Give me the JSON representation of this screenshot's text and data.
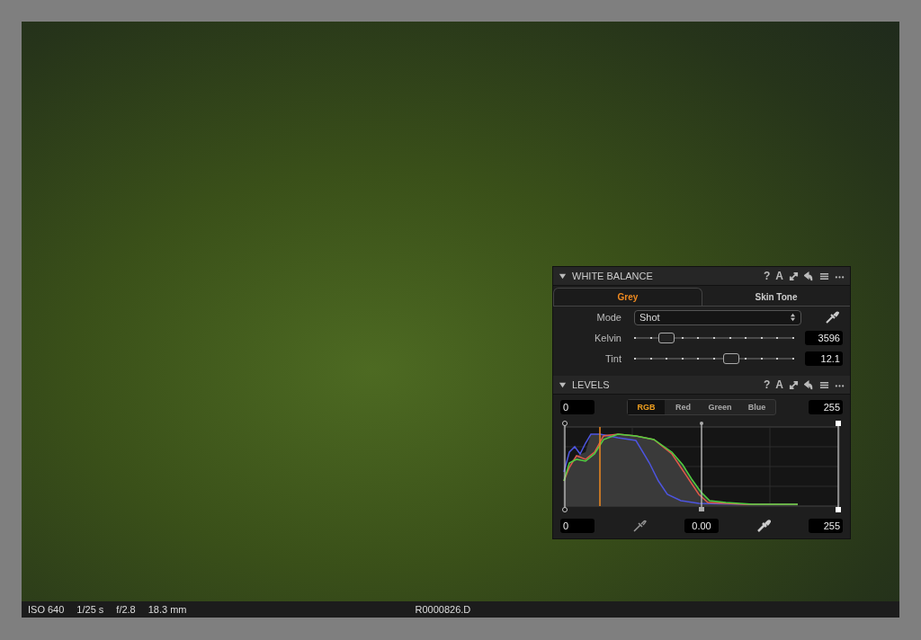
{
  "white_balance": {
    "title": "WHITE BALANCE",
    "expanded": true,
    "tool_labels": [
      "?",
      "A"
    ],
    "tabs": [
      {
        "label": "Grey",
        "selected": true
      },
      {
        "label": "Skin Tone",
        "selected": false
      }
    ],
    "mode": {
      "label": "Mode",
      "value": "Shot"
    },
    "sliders": [
      {
        "label": "Kelvin",
        "level": 0.21,
        "reading": "3596"
      },
      {
        "label": "Tint",
        "level": 0.62,
        "reading": "12.1"
      }
    ]
  },
  "levels": {
    "title": "LEVELS",
    "expanded": true,
    "tool_labels": [
      "?",
      "A"
    ],
    "input_black": "0",
    "input_white": "255",
    "channels": [
      {
        "label": "RGB",
        "selected": true
      },
      {
        "label": "Red",
        "selected": false
      },
      {
        "label": "Green",
        "selected": false
      },
      {
        "label": "Blue",
        "selected": false
      }
    ],
    "output_black": "0",
    "midtone": "0.00",
    "output_white": "255"
  },
  "status_bar": {
    "iso": "ISO 640",
    "shutter": "1/25 s",
    "aperture": "f/2.8",
    "focal_length": "18.3 mm",
    "filename": "R0000826.D"
  }
}
